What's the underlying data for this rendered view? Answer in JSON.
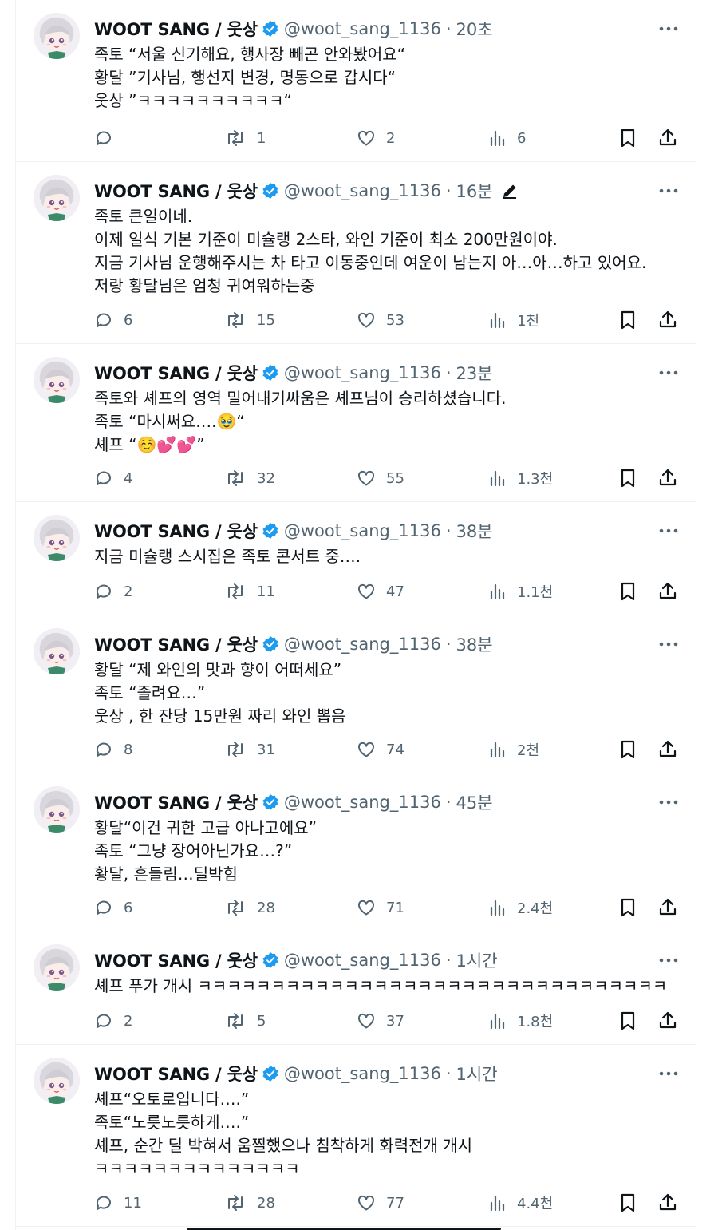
{
  "colors": {
    "text": "#0f1419",
    "secondary": "#536471",
    "verified": "#1d9bf0",
    "divider": "#eff3f4"
  },
  "tweets": [
    {
      "name": "WOOT SANG / 웃상",
      "handle": "@woot_sang_1136",
      "sep": "·",
      "time": "20초",
      "edited": false,
      "lines": [
        "족토 “서울 신기해요, 행사장 빼곤 안와봤어요“",
        "황달 ”기사님, 행선지 변경, 명동으로 갑시다“",
        "웃상 ”ㅋㅋㅋㅋㅋㅋㅋㅋㅋㅋ“"
      ],
      "replies": "",
      "retweets": "1",
      "likes": "2",
      "views": "6"
    },
    {
      "name": "WOOT SANG / 웃상",
      "handle": "@woot_sang_1136",
      "sep": "·",
      "time": "16분",
      "edited": true,
      "lines": [
        "족토 큰일이네.",
        "이제 일식 기본 기준이 미슐랭 2스타, 와인 기준이 최소 200만원이야.",
        "지금 기사님 운행해주시는 차 타고 이동중인데 여운이 남는지 아…아…하고 있어요.",
        "저랑 황달님은 엄청 귀여워하는중"
      ],
      "replies": "6",
      "retweets": "15",
      "likes": "53",
      "views": "1천"
    },
    {
      "name": "WOOT SANG / 웃상",
      "handle": "@woot_sang_1136",
      "sep": "·",
      "time": "23분",
      "edited": false,
      "lines": [
        "족토와 셰프의 영역 밀어내기싸움은 셰프님이 승리하셨습니다.",
        "족토 “마시써요….🥹“",
        "셰프 “☺️💕💕”"
      ],
      "replies": "4",
      "retweets": "32",
      "likes": "55",
      "views": "1.3천"
    },
    {
      "name": "WOOT SANG / 웃상",
      "handle": "@woot_sang_1136",
      "sep": "·",
      "time": "38분",
      "edited": false,
      "lines": [
        "지금 미슐랭 스시집은 족토 콘서트 중…."
      ],
      "replies": "2",
      "retweets": "11",
      "likes": "47",
      "views": "1.1천"
    },
    {
      "name": "WOOT SANG / 웃상",
      "handle": "@woot_sang_1136",
      "sep": "·",
      "time": "38분",
      "edited": false,
      "lines": [
        "황달 “제 와인의 맛과 향이 어떠세요”",
        "족토 “졸려요…”",
        "웃상 , 한 잔당 15만원 짜리 와인 뽑음"
      ],
      "replies": "8",
      "retweets": "31",
      "likes": "74",
      "views": "2천"
    },
    {
      "name": "WOOT SANG / 웃상",
      "handle": "@woot_sang_1136",
      "sep": "·",
      "time": "45분",
      "edited": false,
      "lines": [
        "황달“이건 귀한 고급 아나고에요”",
        "족토 “그냥 장어아닌가요…?”",
        "황달, 흔들림…딜박힘"
      ],
      "replies": "6",
      "retweets": "28",
      "likes": "71",
      "views": "2.4천"
    },
    {
      "name": "WOOT SANG / 웃상",
      "handle": "@woot_sang_1136",
      "sep": "·",
      "time": "1시간",
      "edited": false,
      "lines": [
        "셰프 푸가 개시 ㅋㅋㅋㅋㅋㅋㅋㅋㅋㅋㅋㅋㅋㅋㅋㅋㅋㅋㅋㅋㅋㅋㅋㅋㅋㅋㅋㅋㅋㅋㅋㅋ"
      ],
      "replies": "2",
      "retweets": "5",
      "likes": "37",
      "views": "1.8천"
    },
    {
      "name": "WOOT SANG / 웃상",
      "handle": "@woot_sang_1136",
      "sep": "·",
      "time": "1시간",
      "edited": false,
      "lines": [
        "셰프“오토로입니다….”",
        "족토“노릇노릇하게….”",
        "셰프, 순간 딜 박혀서 움찔했으나 침착하게 화력전개 개시",
        "ㅋㅋㅋㅋㅋㅋㅋㅋㅋㅋㅋㅋㅋㅋ"
      ],
      "replies": "11",
      "retweets": "28",
      "likes": "77",
      "views": "4.4천"
    }
  ]
}
